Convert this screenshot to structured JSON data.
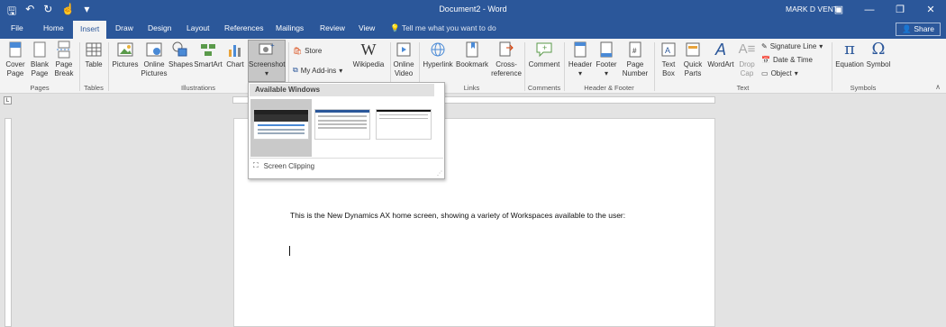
{
  "titlebar": {
    "title": "Document2 - Word",
    "user": "MARK D VENT",
    "minimize_glyph": "—",
    "restore_glyph": "❐",
    "close_glyph": "✕"
  },
  "tabs": [
    "File",
    "Home",
    "Insert",
    "Draw",
    "Design",
    "Layout",
    "References",
    "Mailings",
    "Review",
    "View"
  ],
  "tell_me": "Tell me what you want to do",
  "share": "Share",
  "ribbon": {
    "cover_page": "Cover Page",
    "blank_page": "Blank Page",
    "page_break": "Page Break",
    "table": "Table",
    "pictures": "Pictures",
    "online_pictures": "Online Pictures",
    "shapes": "Shapes",
    "smartart": "SmartArt",
    "chart": "Chart",
    "screenshot": "Screenshot",
    "store": "Store",
    "my_addins": "My Add-ins",
    "wikipedia": "Wikipedia",
    "online_video": "Online Video",
    "hyperlink": "Hyperlink",
    "bookmark": "Bookmark",
    "cross_reference": "Cross-reference",
    "comment": "Comment",
    "header": "Header",
    "footer": "Footer",
    "page_number": "Page Number",
    "text_box": "Text Box",
    "quick_parts": "Quick Parts",
    "wordart": "WordArt",
    "drop_cap": "Drop Cap",
    "signature_line": "Signature Line",
    "date_time": "Date & Time",
    "object": "Object",
    "equation": "Equation",
    "symbol": "Symbol",
    "groups": {
      "pages": "Pages",
      "tables": "Tables",
      "illustrations": "Illustrations",
      "links": "Links",
      "comments": "Comments",
      "header_footer": "Header & Footer",
      "text": "Text",
      "symbols": "Symbols"
    }
  },
  "dropdown": {
    "header": "Available Windows",
    "screen_clipping": "Screen Clipping"
  },
  "document": {
    "text": "This is the New Dynamics AX home screen, showing a variety of Workspaces available to the user:"
  }
}
